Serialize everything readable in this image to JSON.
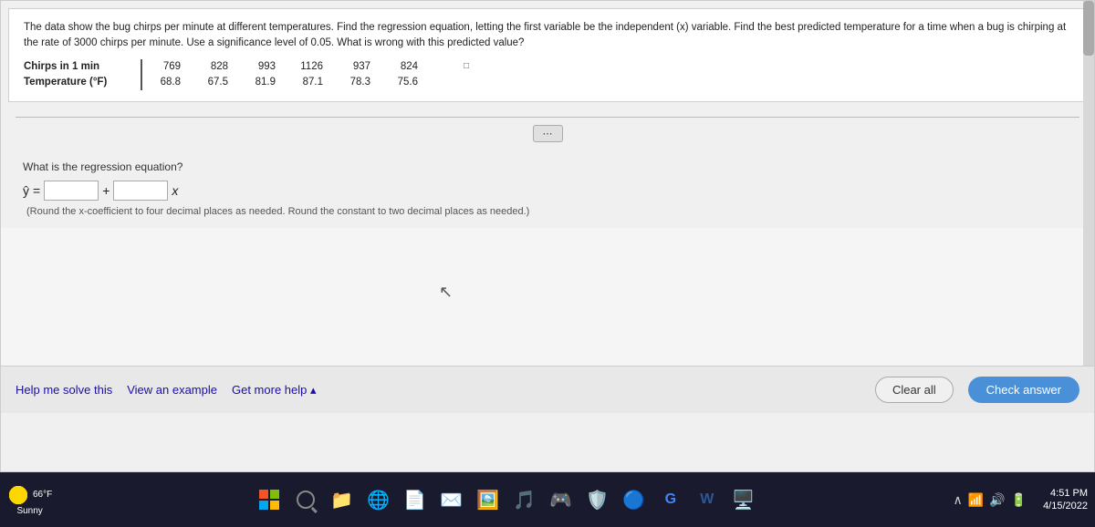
{
  "question": {
    "text": "The data show the bug chirps per minute at different temperatures. Find the regression equation, letting the first variable be the independent (x) variable. Find the best predicted temperature for a time when a bug is chirping at the rate of 3000 chirps per minute. Use a significance level of 0.05. What is wrong with this predicted value?",
    "table": {
      "row1_label": "Chirps in 1 min",
      "row1_values": [
        "769",
        "828",
        "993",
        "1126",
        "937",
        "824"
      ],
      "row2_label": "Temperature (°F)",
      "row2_values": [
        "68.8",
        "67.5",
        "81.9",
        "87.1",
        "78.3",
        "75.6"
      ]
    }
  },
  "regression": {
    "question_label": "What is the regression equation?",
    "equation_prefix": "ŷ =",
    "plus_symbol": "+",
    "x_symbol": "x",
    "round_note": "(Round the x-coefficient to four decimal places as needed. Round the constant to two decimal places as needed.)"
  },
  "actions": {
    "help_label": "Help me solve this",
    "example_label": "View an example",
    "more_help_label": "Get more help ▴",
    "clear_all_label": "Clear all",
    "check_answer_label": "Check answer"
  },
  "taskbar": {
    "weather_temp": "66°F",
    "weather_condition": "Sunny",
    "time": "4:51 PM",
    "date": "4/15/2022"
  },
  "colors": {
    "accent_blue": "#4a90d9",
    "link_blue": "#1a0dab",
    "taskbar_bg": "#1a1a2e"
  }
}
